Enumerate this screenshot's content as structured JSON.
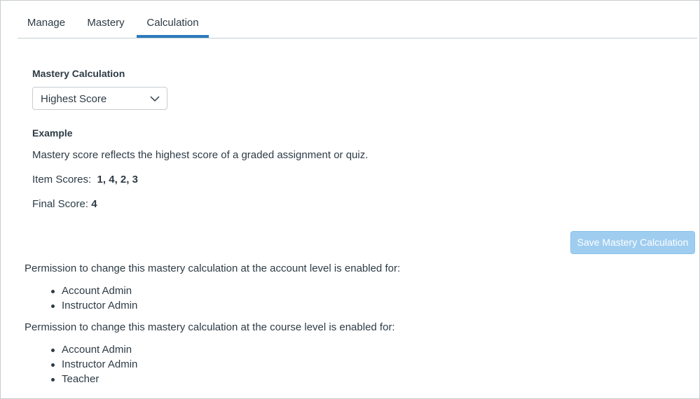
{
  "tabs": [
    {
      "label": "Manage",
      "active": false
    },
    {
      "label": "Mastery",
      "active": false
    },
    {
      "label": "Calculation",
      "active": true
    }
  ],
  "calculation": {
    "label": "Mastery Calculation",
    "selected_method": "Highest Score",
    "dropdown_icon": "chevron-down-icon"
  },
  "example": {
    "heading": "Example",
    "description": "Mastery score reflects the highest score of a graded assignment or quiz.",
    "item_scores_label": "Item Scores:",
    "item_scores_value": "1, 4, 2, 3",
    "final_score_label": "Final Score:",
    "final_score_value": "4"
  },
  "save_button": {
    "label": "Save Mastery Calculation",
    "disabled": true
  },
  "permissions": {
    "account": {
      "text": "Permission to change this mastery calculation at the account level is enabled for:",
      "roles": [
        "Account Admin",
        "Instructor Admin"
      ]
    },
    "course": {
      "text": "Permission to change this mastery calculation at the course level is enabled for:",
      "roles": [
        "Account Admin",
        "Instructor Admin",
        "Teacher"
      ]
    }
  },
  "colors": {
    "accent": "#2b7abc",
    "text": "#2d3b45",
    "border": "#c7cdd1",
    "disabled_button": "#9fcdf0"
  }
}
